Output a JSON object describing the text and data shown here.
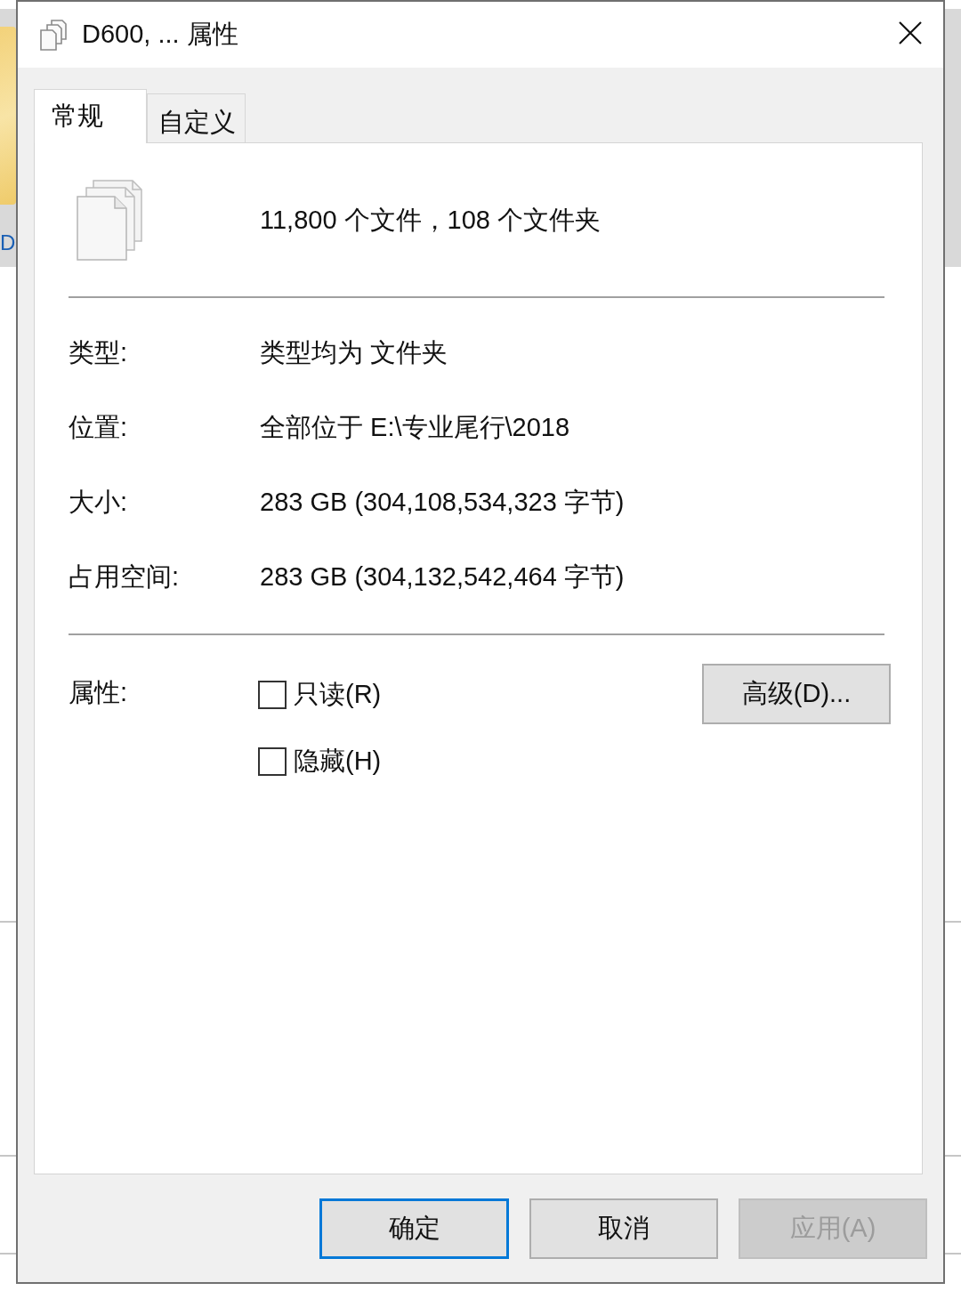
{
  "background": {
    "item_label": "D"
  },
  "window": {
    "title": "D600, ... 属性"
  },
  "tabs": [
    {
      "label": "常规",
      "selected": true
    },
    {
      "label": "自定义",
      "selected": false
    }
  ],
  "summary": "11,800 个文件，108 个文件夹",
  "properties": [
    {
      "label": "类型:",
      "value": "类型均为 文件夹"
    },
    {
      "label": "位置:",
      "value": "全部位于 E:\\专业尾行\\2018"
    },
    {
      "label": "大小:",
      "value": "283 GB (304,108,534,323 字节)"
    },
    {
      "label": "占用空间:",
      "value": "283 GB (304,132,542,464 字节)"
    }
  ],
  "attributes": {
    "label": "属性:",
    "options": [
      {
        "label": "只读(R)",
        "checked": false
      },
      {
        "label": "隐藏(H)",
        "checked": false
      }
    ],
    "advanced_button": "高级(D)..."
  },
  "buttons": [
    {
      "label": "确定",
      "default": true,
      "disabled": false
    },
    {
      "label": "取消",
      "default": false,
      "disabled": false
    },
    {
      "label": "应用(A)",
      "default": false,
      "disabled": true
    }
  ]
}
